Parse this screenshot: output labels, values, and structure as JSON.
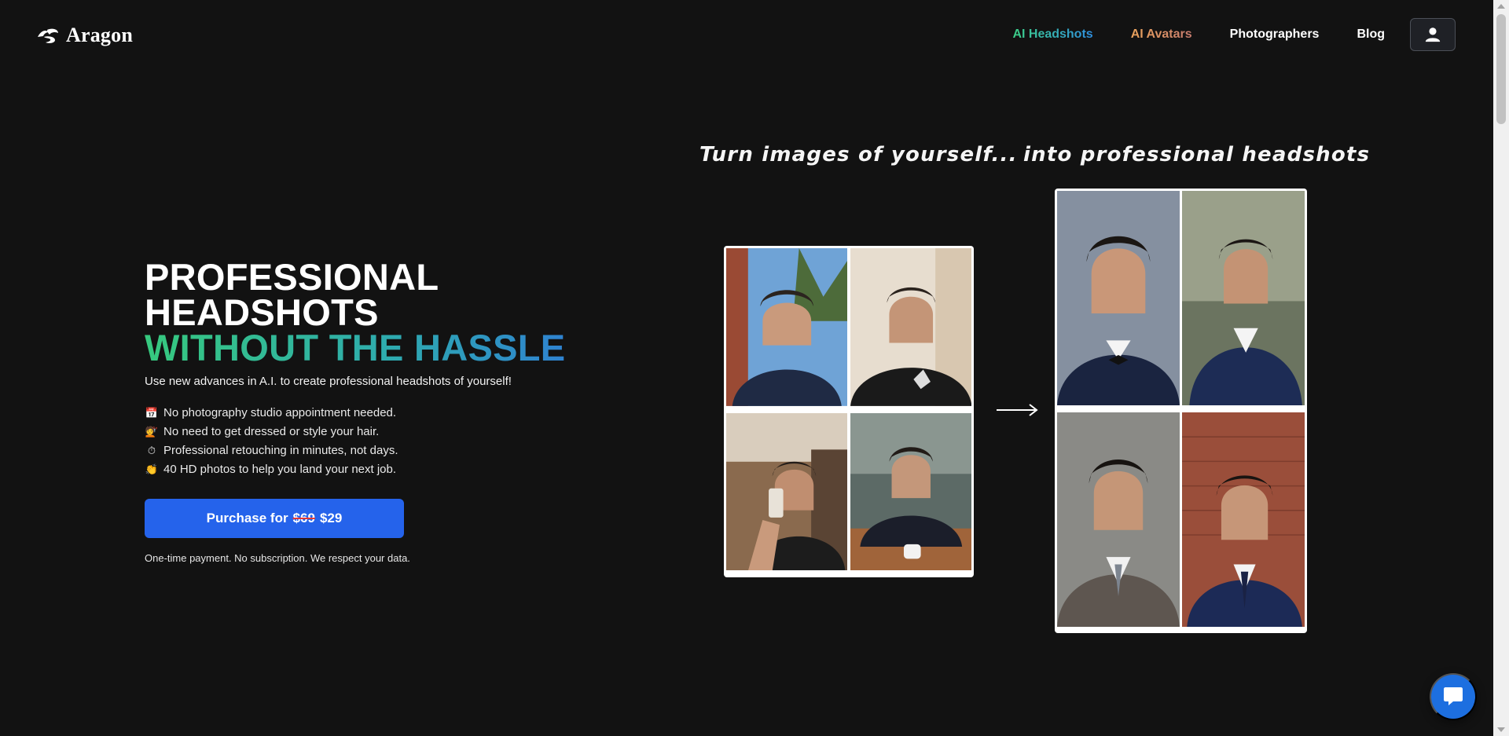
{
  "brand": {
    "name": "Aragon"
  },
  "nav": {
    "items": [
      {
        "label": "AI Headshots"
      },
      {
        "label": "AI Avatars"
      },
      {
        "label": "Photographers"
      },
      {
        "label": "Blog"
      }
    ],
    "account_icon": "user-icon"
  },
  "hero": {
    "title_line1": "PROFESSIONAL",
    "title_line2": "HEADSHOTS",
    "title_line3": "WITHOUT THE HASSLE",
    "subtitle": "Use new advances in A.I. to create professional headshots of yourself!",
    "features": [
      {
        "emoji": "📅",
        "text": "No photography studio appointment needed."
      },
      {
        "emoji": "💇",
        "text": "No need to get dressed or style your hair."
      },
      {
        "emoji": "⏱",
        "text": "Professional retouching in minutes, not days."
      },
      {
        "emoji": "👏",
        "text": "40 HD photos to help you land your next job."
      }
    ],
    "purchase": {
      "prefix": "Purchase for",
      "old_price": "$69",
      "new_price": "$29"
    },
    "footnote": "One-time payment. No subscription. We respect your data."
  },
  "showcase": {
    "caption_before": "Turn images of yourself...",
    "caption_after": "into professional headshots"
  },
  "colors": {
    "background": "#121212",
    "accent": "#2563eb",
    "gradient_start": "#36c97e",
    "gradient_end": "#2f6fe0"
  },
  "chat": {
    "icon": "chat-icon"
  }
}
